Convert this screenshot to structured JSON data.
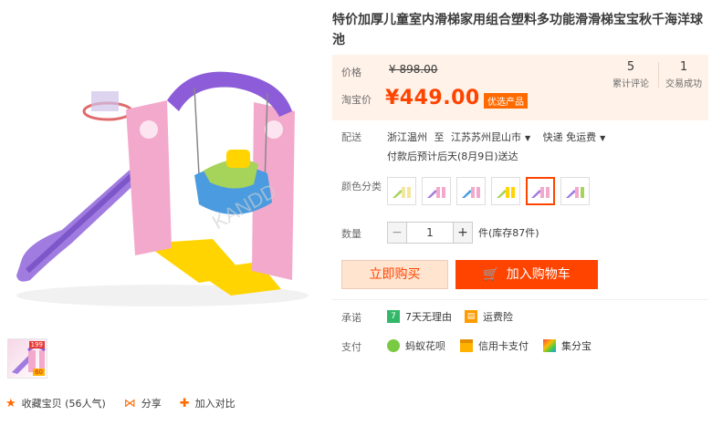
{
  "product": {
    "title": "特价加厚儿童室内滑梯家用组合塑料多功能滑滑梯宝宝秋千海洋球池"
  },
  "price": {
    "orig_label": "价格",
    "orig_value": "¥ 898.00",
    "now_label": "淘宝价",
    "now_value": "¥449.00",
    "badge": "优选产品"
  },
  "stats": [
    {
      "num": "5",
      "label": "累计评论"
    },
    {
      "num": "1",
      "label": "交易成功"
    }
  ],
  "shipping": {
    "label": "配送",
    "from": "浙江温州",
    "to_word": "至",
    "to": "江苏苏州昆山市",
    "method": "快递 免运费",
    "eta": "付款后预计后天(8月9日)送达"
  },
  "color": {
    "label": "颜色分类",
    "swatches": [
      "绿色",
      "紫色1",
      "蓝色",
      "黄绿",
      "紫色(选中)",
      "紫色2"
    ]
  },
  "quantity": {
    "label": "数量",
    "value": "1",
    "minus": "−",
    "plus": "+",
    "stock": "件(库存87件)"
  },
  "buttons": {
    "buy": "立即购买",
    "cart": "加入购物车"
  },
  "promise": {
    "label": "承诺",
    "items": [
      "7天无理由",
      "运费险"
    ]
  },
  "payment": {
    "label": "支付",
    "items": [
      "蚂蚁花呗",
      "信用卡支付",
      "集分宝"
    ]
  },
  "actions": {
    "favorite": "收藏宝贝 (56人气)",
    "share": "分享",
    "compare": "加入对比"
  },
  "thumb": {
    "tag_top": "199",
    "tag_bottom": "60"
  },
  "colors": {
    "accent": "#ff4400",
    "price_bg": "#fff2e8"
  }
}
